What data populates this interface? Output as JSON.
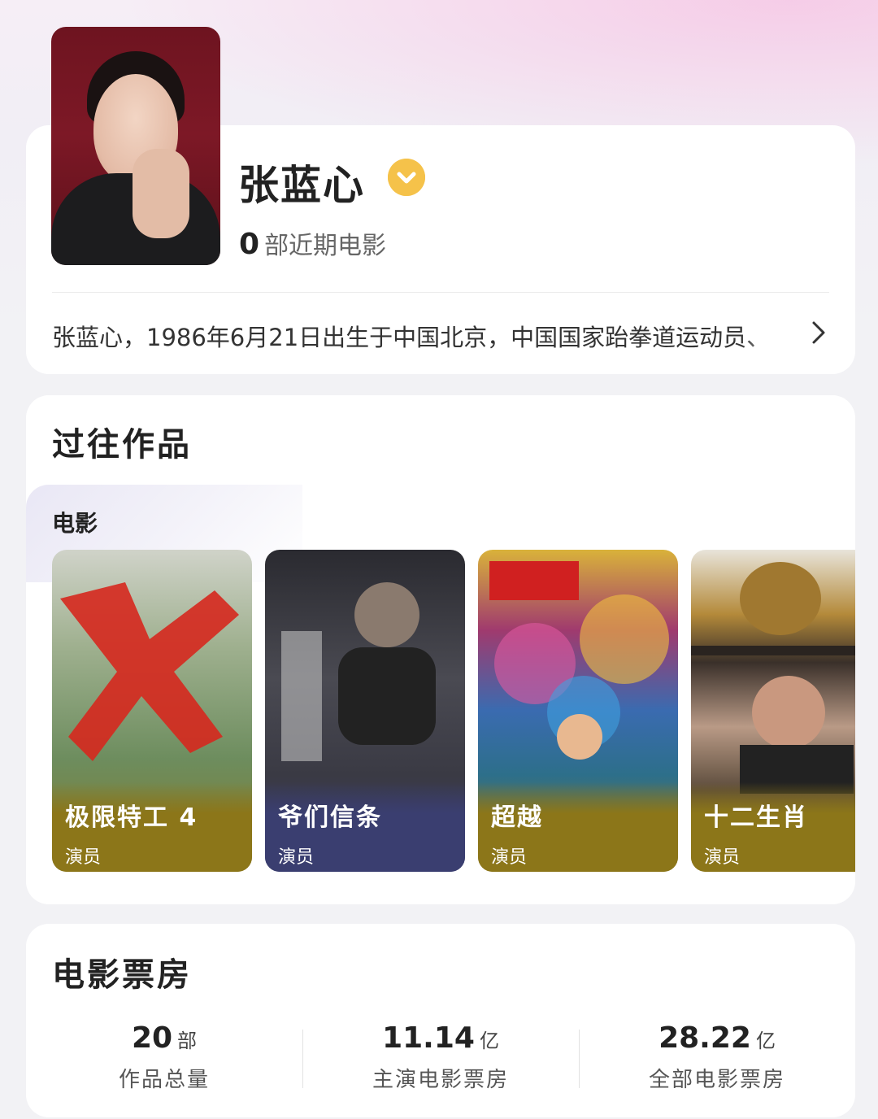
{
  "profile": {
    "name": "张蓝心",
    "recent_count": "0",
    "recent_label": "部近期电影",
    "bio": "张蓝心，1986年6月21日出生于中国北京，中国国家跆拳道运动员、"
  },
  "works": {
    "title": "过往作品",
    "tab_label": "电影",
    "movies": [
      {
        "title": "极限特工 4",
        "role": "演员"
      },
      {
        "title": "爷们信条",
        "role": "演员"
      },
      {
        "title": "超越",
        "role": "演员"
      },
      {
        "title": "十二生肖",
        "role": "演员"
      }
    ]
  },
  "box_office": {
    "title": "电影票房",
    "stats": [
      {
        "value": "20",
        "unit": "部",
        "label": "作品总量"
      },
      {
        "value": "11.14",
        "unit": "亿",
        "label": "主演电影票房"
      },
      {
        "value": "28.22",
        "unit": "亿",
        "label": "全部电影票房"
      }
    ]
  },
  "colors": {
    "verified_badge": "#f5c24a",
    "poster_band_gold": "#8c7619",
    "poster_band_navy": "#3a3e70"
  }
}
